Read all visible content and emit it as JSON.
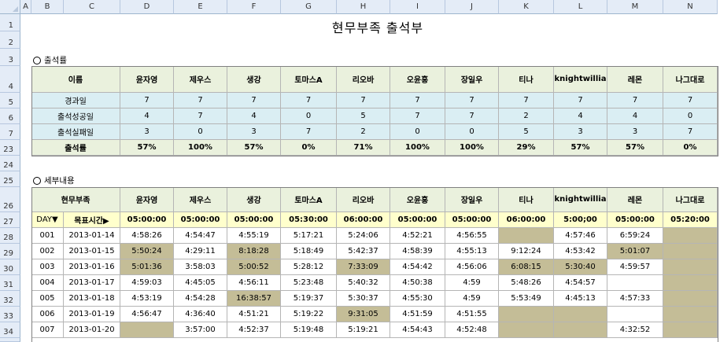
{
  "title": "현무부족 출석부",
  "columns": [
    "A",
    "B",
    "C",
    "D",
    "E",
    "F",
    "G",
    "H",
    "I",
    "J",
    "K",
    "L",
    "M",
    "N"
  ],
  "members": [
    "윤자영",
    "제우스",
    "생강",
    "토마스A",
    "리오바",
    "오윤홍",
    "장일우",
    "티나",
    "knightwillia",
    "레몬",
    "나그대로"
  ],
  "attendance": {
    "section_label": "출석률",
    "header_label": "이름",
    "row_numbers": [
      "4",
      "5",
      "6",
      "7",
      "23"
    ],
    "rows": [
      {
        "label": "경과일",
        "values": [
          "7",
          "7",
          "7",
          "7",
          "7",
          "7",
          "7",
          "7",
          "7",
          "7",
          "7"
        ]
      },
      {
        "label": "출석성공일",
        "values": [
          "4",
          "7",
          "4",
          "0",
          "5",
          "7",
          "7",
          "2",
          "4",
          "4",
          "0"
        ]
      },
      {
        "label": "출석실패일",
        "values": [
          "3",
          "0",
          "3",
          "7",
          "2",
          "0",
          "0",
          "5",
          "3",
          "3",
          "7"
        ]
      },
      {
        "label": "출석률",
        "values": [
          "57%",
          "100%",
          "57%",
          "0%",
          "71%",
          "100%",
          "100%",
          "29%",
          "57%",
          "57%",
          "0%"
        ]
      }
    ]
  },
  "detail": {
    "section_label": "세부내용",
    "header_label": "현무부족",
    "day_label": "DAY▼",
    "target_label": "목표시간▶",
    "targets": [
      "05:00:00",
      "05:00:00",
      "05:00:00",
      "05:30:00",
      "06:00:00",
      "05:00:00",
      "05:00:00",
      "06:00:00",
      "5:00;00",
      "05:00:00",
      "05:20:00"
    ],
    "rows": [
      {
        "day": "001",
        "date": "2013-01-14",
        "times": [
          "4:58:26",
          "4:54:47",
          "4:55:19",
          "5:17:21",
          "5:24:06",
          "4:52:21",
          "4:56:55",
          "",
          "4:57:46",
          "6:59:24",
          ""
        ],
        "miss": [
          false,
          false,
          false,
          false,
          false,
          false,
          false,
          true,
          false,
          false,
          true
        ]
      },
      {
        "day": "002",
        "date": "2013-01-15",
        "times": [
          "5:50:24",
          "4:29:11",
          "8:18:28",
          "5:18:49",
          "5:42:37",
          "4:58:39",
          "4:55:13",
          "9:12:24",
          "4:53:42",
          "5:01:07",
          ""
        ],
        "miss": [
          true,
          false,
          true,
          false,
          false,
          false,
          false,
          false,
          false,
          true,
          true
        ]
      },
      {
        "day": "003",
        "date": "2013-01-16",
        "times": [
          "5:01:36",
          "3:58:03",
          "5:00:52",
          "5:28:12",
          "7:33:09",
          "4:54:42",
          "4:56:06",
          "6:08:15",
          "5:30:40",
          "4:59:57",
          ""
        ],
        "miss": [
          true,
          false,
          true,
          false,
          true,
          false,
          false,
          true,
          true,
          false,
          true
        ]
      },
      {
        "day": "004",
        "date": "2013-01-17",
        "times": [
          "4:59:03",
          "4:45:05",
          "4:56:11",
          "5:23:48",
          "5:40:32",
          "4:50:38",
          "4:59",
          "5:48:26",
          "4:54:57",
          "",
          ""
        ],
        "miss": [
          false,
          false,
          false,
          false,
          false,
          false,
          false,
          false,
          false,
          false,
          true
        ]
      },
      {
        "day": "005",
        "date": "2013-01-18",
        "times": [
          "4:53:19",
          "4:54:28",
          "16:38:57",
          "5:19:37",
          "5:30:37",
          "4:55:30",
          "4:59",
          "5:53:49",
          "4:45:13",
          "4:57:33",
          ""
        ],
        "miss": [
          false,
          false,
          true,
          false,
          false,
          false,
          false,
          false,
          false,
          false,
          true
        ]
      },
      {
        "day": "006",
        "date": "2013-01-19",
        "times": [
          "4:56:47",
          "4:36:40",
          "4:51:21",
          "5:19:22",
          "9:31:05",
          "4:51:59",
          "4:51:55",
          "",
          "",
          "",
          ""
        ],
        "miss": [
          false,
          false,
          false,
          false,
          true,
          false,
          false,
          true,
          true,
          false,
          true
        ]
      },
      {
        "day": "007",
        "date": "2013-01-20",
        "times": [
          "",
          "3:57:00",
          "4:52:37",
          "5:19:48",
          "5:19:21",
          "4:54:43",
          "4:52:48",
          "",
          "",
          "4:32:52",
          ""
        ],
        "miss": [
          true,
          false,
          false,
          false,
          false,
          false,
          false,
          true,
          true,
          false,
          true
        ]
      }
    ]
  },
  "colors": {
    "header_bg": "#eaf1dd",
    "row_blue": "#daeef3",
    "target_yellow": "#ffffcc",
    "miss": "#c4bd97",
    "grid": "#b5b5b5"
  }
}
